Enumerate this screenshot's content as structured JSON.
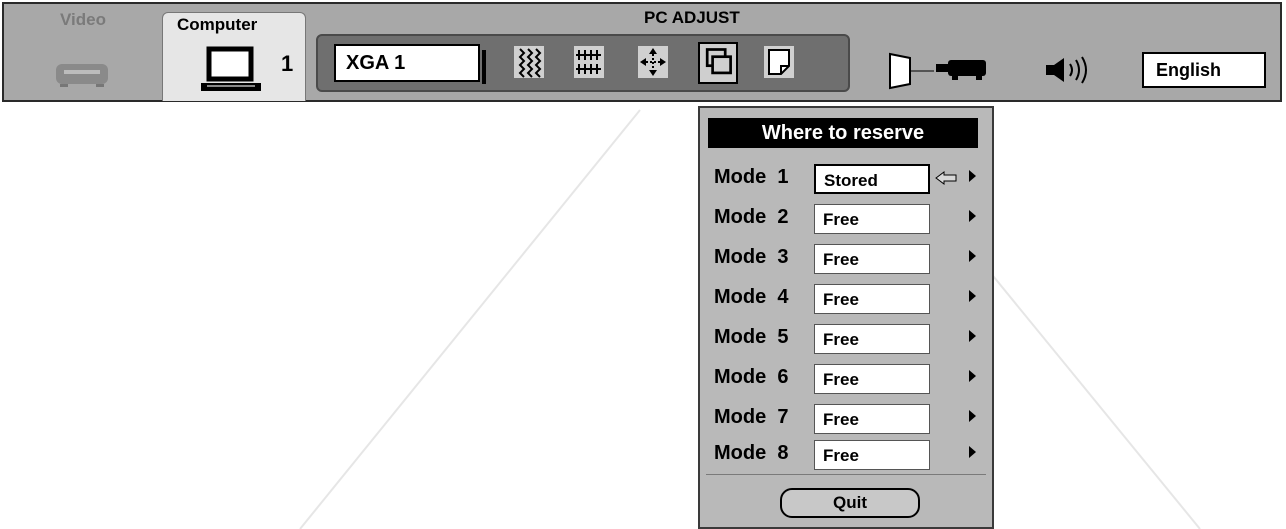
{
  "header": {
    "title": "PC ADJUST",
    "tabs": [
      {
        "label": "Video",
        "active": false
      },
      {
        "label": "Computer",
        "active": true,
        "input_number": "1"
      }
    ],
    "mode_display": "XGA 1",
    "language": "English",
    "icons": [
      "fine-sync-icon",
      "total-dots-icon",
      "position-icon",
      "store-icon",
      "quit-icon",
      "screen-icon",
      "projector-icon",
      "speaker-icon"
    ]
  },
  "popup": {
    "title": "Where to reserve",
    "rows": [
      {
        "label": "Mode",
        "number": "1",
        "value": "Stored"
      },
      {
        "label": "Mode",
        "number": "2",
        "value": "Free"
      },
      {
        "label": "Mode",
        "number": "3",
        "value": "Free"
      },
      {
        "label": "Mode",
        "number": "4",
        "value": "Free"
      },
      {
        "label": "Mode",
        "number": "5",
        "value": "Free"
      },
      {
        "label": "Mode",
        "number": "6",
        "value": "Free"
      },
      {
        "label": "Mode",
        "number": "7",
        "value": "Free"
      },
      {
        "label": "Mode",
        "number": "8",
        "value": "Free"
      }
    ],
    "quit_label": "Quit"
  },
  "colors": {
    "bar": "#a8a8a8",
    "panel": "#6f6f6f",
    "popup": "#b9b9b9"
  }
}
